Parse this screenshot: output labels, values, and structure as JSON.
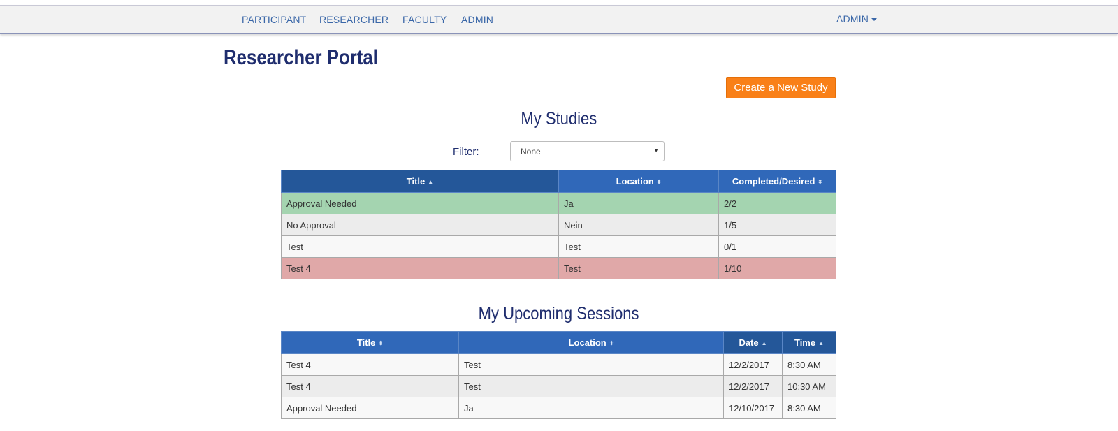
{
  "nav": {
    "links": [
      "PARTICIPANT",
      "RESEARCHER",
      "FACULTY",
      "ADMIN"
    ],
    "user_menu": "ADMIN"
  },
  "page": {
    "title": "Researcher Portal",
    "create_button": "Create a New Study"
  },
  "studies": {
    "title": "My Studies",
    "filter_label": "Filter:",
    "filter_value": "None",
    "headers": [
      "Title",
      "Location",
      "Completed/Desired"
    ],
    "rows": [
      [
        "Approval Needed",
        "Ja",
        "2/2"
      ],
      [
        "No Approval",
        "Nein",
        "1/5"
      ],
      [
        "Test",
        "Test",
        "0/1"
      ],
      [
        "Test 4",
        "Test",
        "1/10"
      ]
    ]
  },
  "sessions": {
    "title": "My Upcoming Sessions",
    "headers": [
      "Title",
      "Location",
      "Date",
      "Time"
    ],
    "rows": [
      [
        "Test 4",
        "Test",
        "12/2/2017",
        "8:30 AM"
      ],
      [
        "Test 4",
        "Test",
        "12/2/2017",
        "10:30 AM"
      ],
      [
        "Approval Needed",
        "Ja",
        "12/10/2017",
        "8:30 AM"
      ]
    ]
  },
  "colors": {
    "header_blue": "#3068b9",
    "header_sorted": "#245799",
    "row_green": "#a4d4b0",
    "row_red": "#e0a8a8",
    "button_orange": "#f98018",
    "title_navy": "#1f2d6e"
  },
  "icons": {
    "sort_asc": "sort-asc-icon",
    "sort_both": "sort-icon",
    "caret": "caret-down-icon"
  }
}
